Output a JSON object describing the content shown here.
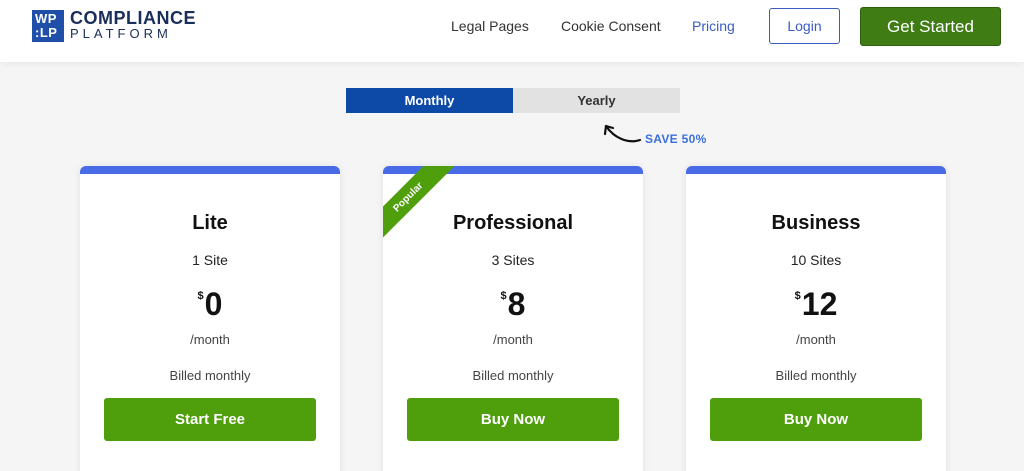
{
  "header": {
    "logo_mark_line1": "WP",
    "logo_mark_line2": ":LP",
    "logo_line1": "COMPLIANCE",
    "logo_line2": "PLATFORM",
    "nav": [
      {
        "label": "Legal Pages"
      },
      {
        "label": "Cookie Consent"
      },
      {
        "label": "Pricing"
      }
    ],
    "login_label": "Login",
    "get_started_label": "Get Started"
  },
  "billing_toggle": {
    "monthly_label": "Monthly",
    "yearly_label": "Yearly",
    "save_note": "SAVE  50%"
  },
  "plans": [
    {
      "name": "Lite",
      "sites": "1 Site",
      "currency": "$",
      "price": "0",
      "period": "/month",
      "billed": "Billed monthly",
      "cta": "Start Free"
    },
    {
      "name": "Professional",
      "sites": "3 Sites",
      "currency": "$",
      "price": "8",
      "period": "/month",
      "billed": "Billed monthly",
      "cta": "Buy Now",
      "ribbon": "Popular"
    },
    {
      "name": "Business",
      "sites": "10 Sites",
      "currency": "$",
      "price": "12",
      "period": "/month",
      "billed": "Billed monthly",
      "cta": "Buy Now"
    }
  ],
  "colors": {
    "brand_blue": "#1f4fa8",
    "accent_green": "#4f9e0c",
    "card_topbar": "#4a6be8"
  }
}
